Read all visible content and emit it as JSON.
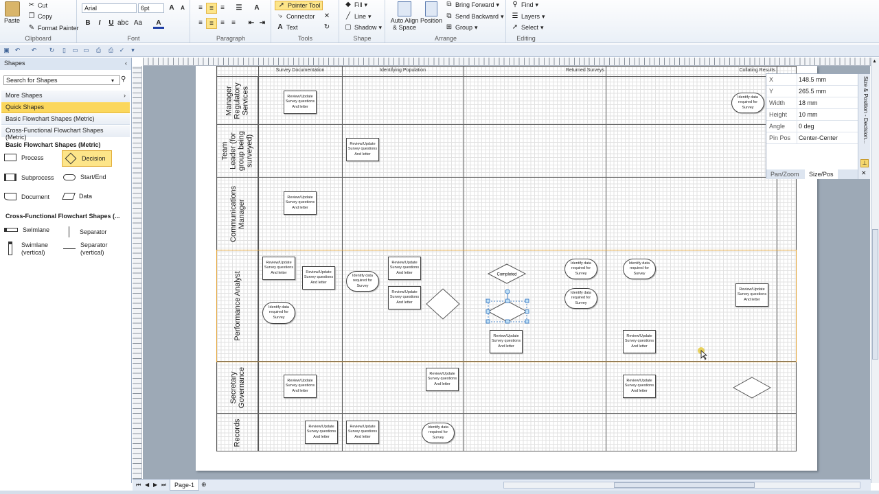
{
  "ribbon": {
    "clipboard": {
      "paste": "Paste",
      "cut": "Cut",
      "copy": "Copy",
      "format_painter": "Format Painter",
      "label": "Clipboard"
    },
    "font": {
      "family": "Arial",
      "size": "6pt",
      "label": "Font"
    },
    "paragraph": {
      "label": "Paragraph"
    },
    "tools": {
      "pointer": "Pointer Tool",
      "connector": "Connector",
      "text": "Text",
      "label": "Tools"
    },
    "shape": {
      "fill": "Fill",
      "line": "Line",
      "shadow": "Shadow",
      "label": "Shape"
    },
    "arrange": {
      "auto_align": "Auto Align & Space",
      "position": "Position",
      "bring_forward": "Bring Forward",
      "send_backward": "Send Backward",
      "group": "Group",
      "label": "Arrange"
    },
    "editing": {
      "find": "Find",
      "layers": "Layers",
      "select": "Select",
      "label": "Editing"
    }
  },
  "shapes_panel": {
    "title": "Shapes",
    "search_placeholder": "Search for Shapes",
    "rows": [
      "More Shapes",
      "Quick Shapes",
      "Basic Flowchart Shapes (Metric)",
      "Cross-Functional Flowchart Shapes (Metric)"
    ],
    "basic_header": "Basic Flowchart Shapes (Metric)",
    "basic": [
      "Process",
      "Decision",
      "Subprocess",
      "Start/End",
      "Document",
      "Data"
    ],
    "cf_header": "Cross-Functional Flowchart Shapes (...",
    "cf": [
      "Swimlane",
      "Separator",
      "Swimlane (vertical)",
      "Separator (vertical)"
    ]
  },
  "diagram": {
    "phases": [
      "Survey Documentation",
      "Identifying Population",
      "Returned Surveys",
      "Collating Results"
    ],
    "lanes": [
      "Manager Regulatory Services",
      "Team Leader (for group being surveyed)",
      "Communications Manager",
      "Performance Analyst",
      "Secretary Governance",
      "Records"
    ],
    "process_text": "Review/Update Survey questions And letter",
    "identify_text": "Identify data required for Survey",
    "completed": "Completed"
  },
  "size_pos": {
    "rows": [
      {
        "k": "X",
        "v": "148.5 mm"
      },
      {
        "k": "Y",
        "v": "265.5 mm"
      },
      {
        "k": "Width",
        "v": "18 mm"
      },
      {
        "k": "Height",
        "v": "10 mm"
      },
      {
        "k": "Angle",
        "v": "0 deg"
      },
      {
        "k": "Pin Pos",
        "v": "Center-Center"
      }
    ],
    "tabs": [
      "Pan/Zoom",
      "Size/Pos"
    ],
    "title": "Size & Position - Decision..."
  },
  "page_tab": "Page-1"
}
